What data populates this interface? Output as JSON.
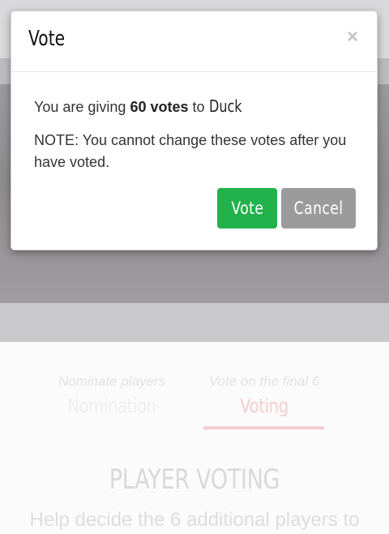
{
  "modal": {
    "title": "Vote",
    "close_label": "×",
    "message_prefix": "You are giving ",
    "votes_text": "60 votes",
    "message_mid": " to ",
    "player_name": "Duck",
    "note": "NOTE: You cannot change these votes after you have voted.",
    "vote_button": "Vote",
    "cancel_button": "Cancel"
  },
  "tabs": [
    {
      "subtitle": "Nominate players",
      "title": "Nomination",
      "active": false
    },
    {
      "subtitle": "Vote on the final 6",
      "title": "Voting",
      "active": true
    }
  ],
  "page": {
    "heading": "PLAYER VOTING",
    "subtitle": "Help decide the 6 additional players to"
  },
  "colors": {
    "vote_button": "#22b24c",
    "cancel_button": "#9b9b9b",
    "active_tab_underline": "#f1cfcf"
  }
}
